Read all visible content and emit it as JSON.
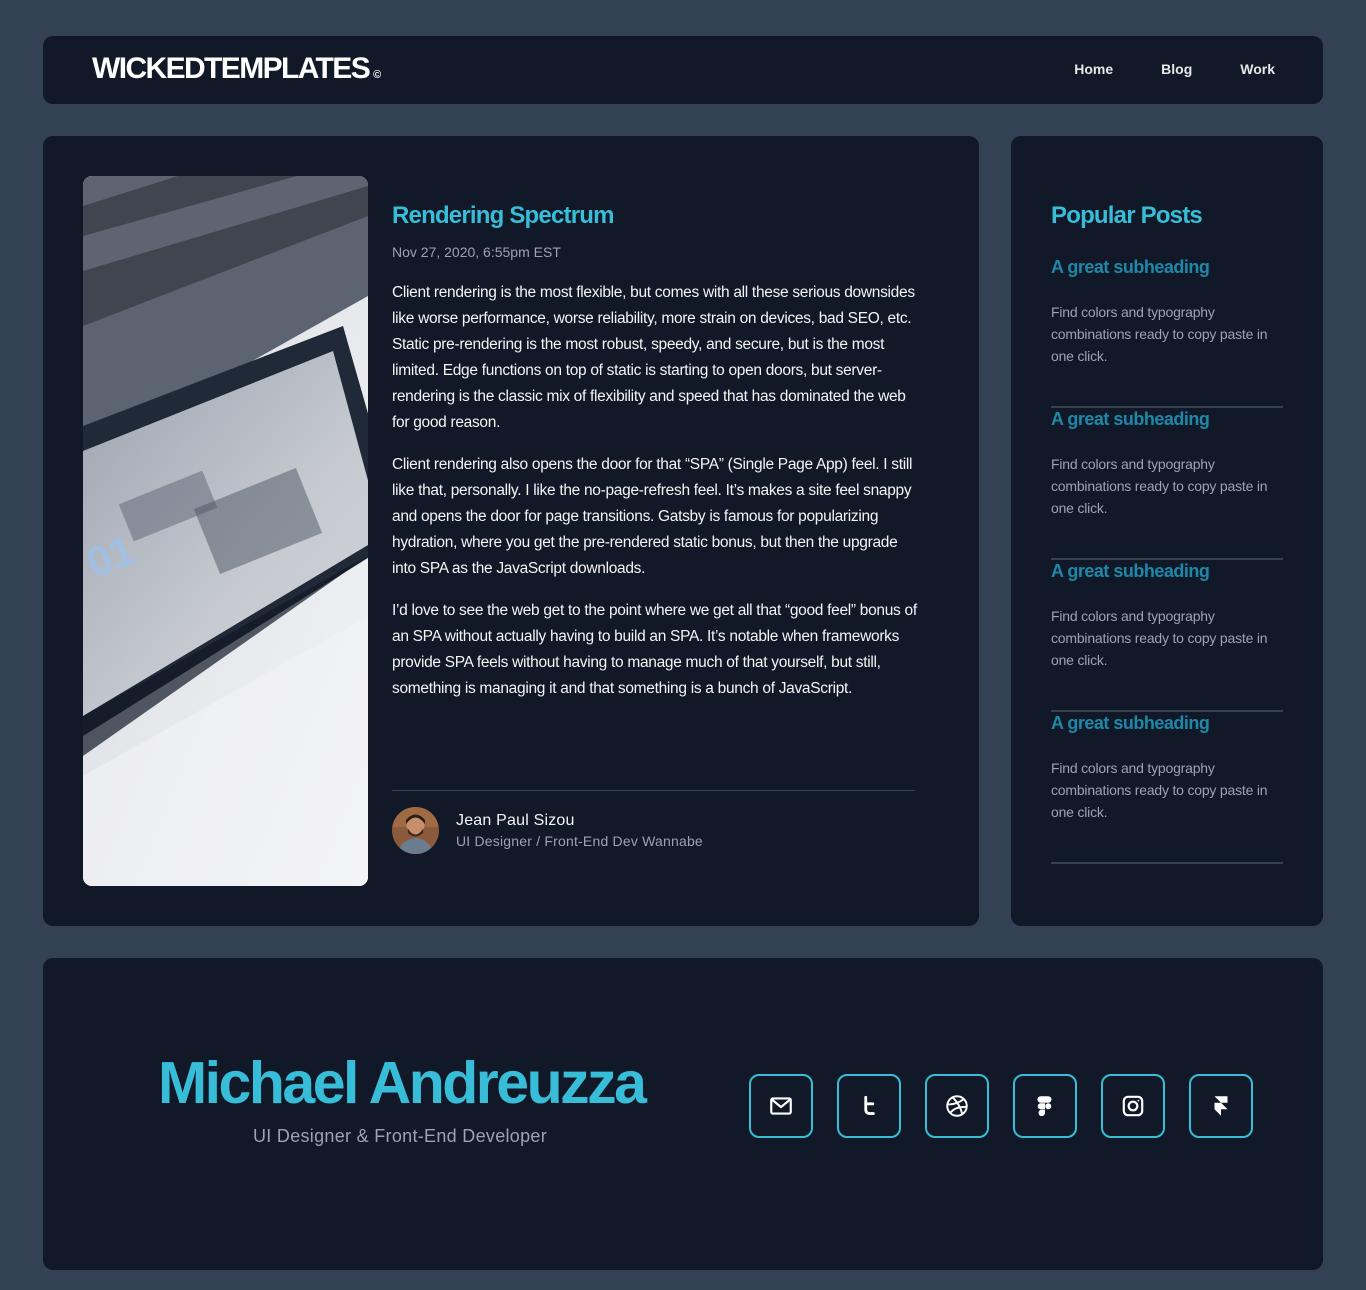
{
  "header": {
    "logo_text": "WICKEDTEMPLATES",
    "logo_mark": "©",
    "nav": [
      {
        "label": "Home"
      },
      {
        "label": "Blog"
      },
      {
        "label": "Work"
      }
    ]
  },
  "article": {
    "image": "phone-on-desk-photo",
    "title": "Rendering Spectrum",
    "date": "Nov 27, 2020, 6:55pm EST",
    "paragraphs": [
      "Client rendering is the most flexible, but comes with all these serious downsides like worse performance, worse reliability, more strain on devices, bad SEO, etc. Static pre-rendering is the most robust, speedy, and secure, but is the most limited. Edge functions on top of static is starting to open doors, but server-rendering is the classic mix of flexibility and speed that has dominated the web for good reason.",
      "Client rendering also opens the door for that “SPA” (Single Page App) feel. I still like that, personally. I like the no-page-refresh feel. It’s makes a site feel snappy and opens the door for page transitions. Gatsby is famous for popularizing hydration, where you get the pre-rendered static bonus, but then the upgrade into SPA as the JavaScript downloads.",
      "I’d love to see the web get to the point where we get all that “good feel” bonus of an SPA without actually having to build an SPA. It’s notable when frameworks provide SPA feels without having to manage much of that yourself, but still, something is managing it and that something is a bunch of JavaScript."
    ],
    "author": {
      "name": "Jean Paul Sizou",
      "role": "UI Designer / Front-End Dev Wannabe"
    }
  },
  "sidebar": {
    "title": "Popular Posts",
    "posts": [
      {
        "subheading": "A great subheading",
        "description": "Find colors and typography combinations ready to copy paste in one click."
      },
      {
        "subheading": "A great subheading",
        "description": "Find colors and typography combinations ready to copy paste in one click."
      },
      {
        "subheading": "A great subheading",
        "description": "Find colors and typography combinations ready to copy paste in one click."
      },
      {
        "subheading": "A great subheading",
        "description": "Find colors and typography combinations ready to copy paste in one click."
      }
    ]
  },
  "footer": {
    "name": "Michael Andreuzza",
    "role": "UI Designer & Front-End Developer",
    "socials": [
      "mail-icon",
      "twitter-icon",
      "dribbble-icon",
      "figma-icon",
      "instagram-icon",
      "framer-icon"
    ]
  },
  "colors": {
    "background": "#334155",
    "panel": "#111827",
    "accent": "#38bdd8",
    "subheading": "#1e88a8",
    "muted": "#9ca3af"
  }
}
